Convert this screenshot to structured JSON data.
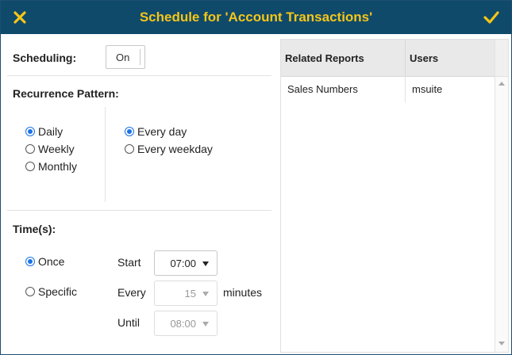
{
  "dialog": {
    "title": "Schedule for 'Account Transactions'",
    "close_icon": "close-icon",
    "confirm_icon": "checkmark-icon",
    "colors": {
      "titlebar": "#0f4a6b",
      "title_text": "#f5c518",
      "radio_selected": "#1a73e8"
    }
  },
  "scheduling": {
    "label": "Scheduling:",
    "toggle_value": "On"
  },
  "recurrence": {
    "label": "Recurrence Pattern:",
    "patterns": [
      {
        "label": "Daily",
        "selected": true
      },
      {
        "label": "Weekly",
        "selected": false
      },
      {
        "label": "Monthly",
        "selected": false
      }
    ],
    "daily_options": [
      {
        "label": "Every day",
        "selected": true
      },
      {
        "label": "Every weekday",
        "selected": false
      }
    ]
  },
  "times": {
    "label": "Time(s):",
    "modes": [
      {
        "label": "Once",
        "selected": true
      },
      {
        "label": "Specific",
        "selected": false
      }
    ],
    "start_label": "Start",
    "start_value": "07:00",
    "every_label": "Every",
    "every_value": "15",
    "every_unit": "minutes",
    "until_label": "Until",
    "until_value": "08:00"
  },
  "grid": {
    "columns": [
      "Related Reports",
      "Users"
    ],
    "rows": [
      {
        "report": "Sales Numbers",
        "user": "msuite"
      }
    ]
  }
}
